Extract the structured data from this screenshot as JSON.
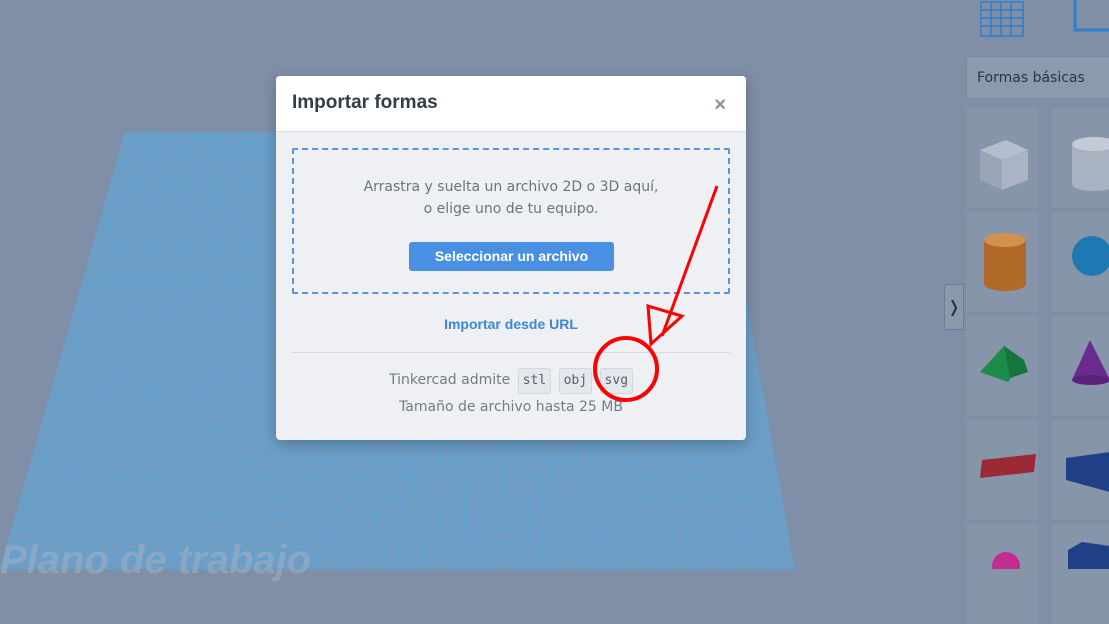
{
  "workplane": {
    "label": "Plano de trabajo"
  },
  "panel": {
    "dropdown_label": "Formas básicas"
  },
  "modal": {
    "title": "Importar formas",
    "close_glyph": "×",
    "drop_text_1": "Arrastra y suelta un archivo 2D o 3D aquí,",
    "drop_text_2": "o elige uno de tu equipo.",
    "select_button": "Seleccionar un archivo",
    "url_link": "Importar desde URL",
    "supports_label": "Tinkercad admite",
    "formats": [
      "stl",
      "obj",
      "svg"
    ],
    "size_text": "Tamaño de archivo hasta 25 MB"
  },
  "colors": {
    "backdrop": "#7f8fa7",
    "grid": "#4fa3d6",
    "accent": "#4a90e2",
    "annotation": "#ff0000"
  },
  "shapes": [
    "box-icon",
    "cylinder-hole-icon",
    "cylinder-icon",
    "sphere-icon",
    "roof-icon",
    "cone-icon",
    "text-icon",
    "wedge-icon",
    "torus-icon",
    "polygon-icon"
  ]
}
